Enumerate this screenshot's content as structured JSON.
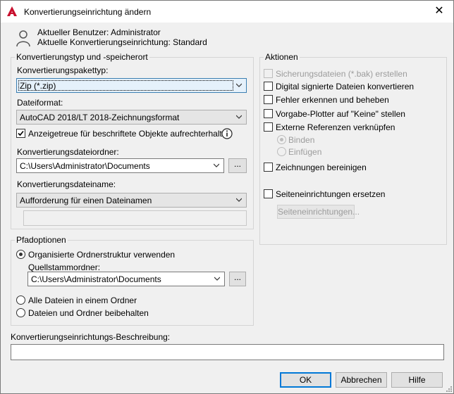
{
  "window": {
    "title": "Konvertierungseinrichtung ändern",
    "close_glyph": "✕",
    "brand_color": "#c8102e"
  },
  "user_info": {
    "current_user": "Aktueller Benutzer: Administrator",
    "current_setup": "Aktuelle Konvertierungseinrichtung: Standard"
  },
  "conversion": {
    "legend": "Konvertierungstyp und -speicherort",
    "package_type_label": "Konvertierungspakettyp:",
    "package_type_value": "Zip (*.zip)",
    "file_format_label": "Dateiformat:",
    "file_format_value": "AutoCAD 2018/LT 2018-Zeichnungsformat",
    "annotative_label": "Anzeigetreue für beschriftete Objekte aufrechterhalten",
    "annotative_checked": true,
    "folder_label": "Konvertierungsdateiordner:",
    "folder_value": "C:\\Users\\Administrator\\Documents",
    "browse_label": "...",
    "filename_label": "Konvertierungsdateiname:",
    "filename_value": "Aufforderung für einen Dateinamen",
    "filename_text": ""
  },
  "path_options": {
    "legend": "Pfadoptionen",
    "organized_label": "Organisierte Ordnerstruktur verwenden",
    "source_root_label": "Quellstammordner:",
    "source_root_value": "C:\\Users\\Administrator\\Documents",
    "browse_label": "...",
    "all_in_one_label": "Alle Dateien in einem Ordner",
    "keep_label": "Dateien und Ordner beibehalten",
    "selected": "organized"
  },
  "actions": {
    "legend": "Aktionen",
    "backup_label": "Sicherungsdateien (*.bak) erstellen",
    "digital_label": "Digital signierte Dateien konvertieren",
    "errors_label": "Fehler erkennen und beheben",
    "plotter_label": "Vorgabe-Plotter auf \"Keine\" stellen",
    "xref_label": "Externe Referenzen verknüpfen",
    "bind_label": "Binden",
    "insert_label": "Einfügen",
    "purge_label": "Zeichnungen bereinigen",
    "page_setup_label": "Seiteneinrichtungen ersetzen",
    "page_setup_button": "Seiteneinrichtungen..."
  },
  "description": {
    "label": "Konvertierungseinrichtungs-Beschreibung:",
    "value": ""
  },
  "footer": {
    "ok": "OK",
    "cancel": "Abbrechen",
    "help": "Hilfe"
  }
}
